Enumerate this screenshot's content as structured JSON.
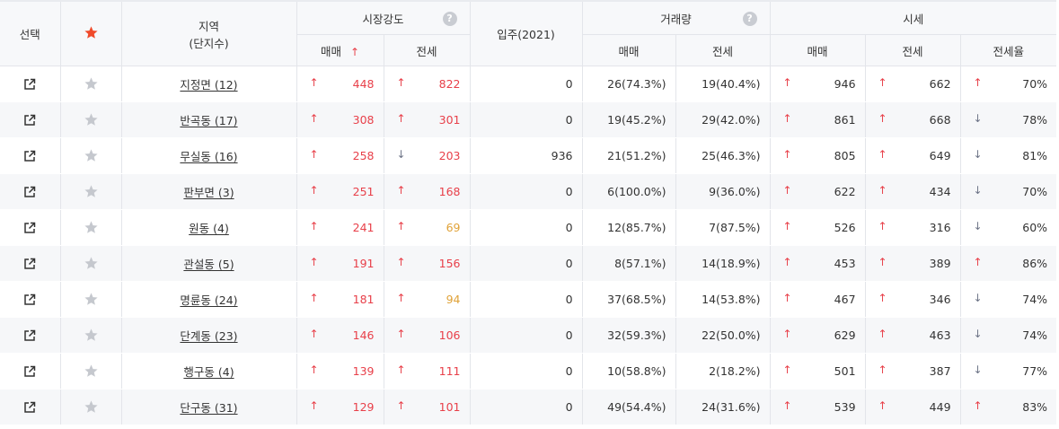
{
  "header": {
    "select": "선택",
    "region_line1": "지역",
    "region_line2": "(단지수)",
    "market_strength": "시장강도",
    "move_in": "입주(2021)",
    "volume": "거래량",
    "price": "시세",
    "sale": "매매",
    "jeonse": "전세",
    "jeonse_ratio": "전세율",
    "help_glyph": "?",
    "sort_glyph": "↑"
  },
  "colors": {
    "up": "#e8404a",
    "down": "#6d7487",
    "star_fav": "#f04a2a",
    "star": "#c5c8ce",
    "orange": "#e0a238"
  },
  "rows": [
    {
      "region": "지정면 (12)",
      "ms_sale_dir": "up",
      "ms_sale": "448",
      "ms_jeonse_dir": "up",
      "ms_jeonse": "822",
      "ms_jeonse_color": "red",
      "move_in": "0",
      "vol_sale": "26(74.3%)",
      "vol_jeonse": "19(40.4%)",
      "p_sale_dir": "up",
      "p_sale": "946",
      "p_jeonse_dir": "up",
      "p_jeonse": "662",
      "ratio_dir": "up",
      "ratio": "70%"
    },
    {
      "region": "반곡동 (17)",
      "ms_sale_dir": "up",
      "ms_sale": "308",
      "ms_jeonse_dir": "up",
      "ms_jeonse": "301",
      "ms_jeonse_color": "red",
      "move_in": "0",
      "vol_sale": "19(45.2%)",
      "vol_jeonse": "29(42.0%)",
      "p_sale_dir": "up",
      "p_sale": "861",
      "p_jeonse_dir": "up",
      "p_jeonse": "668",
      "ratio_dir": "down",
      "ratio": "78%"
    },
    {
      "region": "무실동 (16)",
      "ms_sale_dir": "up",
      "ms_sale": "258",
      "ms_jeonse_dir": "down",
      "ms_jeonse": "203",
      "ms_jeonse_color": "red",
      "move_in": "936",
      "vol_sale": "21(51.2%)",
      "vol_jeonse": "25(46.3%)",
      "p_sale_dir": "up",
      "p_sale": "805",
      "p_jeonse_dir": "up",
      "p_jeonse": "649",
      "ratio_dir": "down",
      "ratio": "81%"
    },
    {
      "region": "판부면 (3)",
      "ms_sale_dir": "up",
      "ms_sale": "251",
      "ms_jeonse_dir": "up",
      "ms_jeonse": "168",
      "ms_jeonse_color": "red",
      "move_in": "0",
      "vol_sale": "6(100.0%)",
      "vol_jeonse": "9(36.0%)",
      "p_sale_dir": "up",
      "p_sale": "622",
      "p_jeonse_dir": "up",
      "p_jeonse": "434",
      "ratio_dir": "down",
      "ratio": "70%"
    },
    {
      "region": "원동 (4)",
      "ms_sale_dir": "up",
      "ms_sale": "241",
      "ms_jeonse_dir": "up",
      "ms_jeonse": "69",
      "ms_jeonse_color": "orange",
      "move_in": "0",
      "vol_sale": "12(85.7%)",
      "vol_jeonse": "7(87.5%)",
      "p_sale_dir": "up",
      "p_sale": "526",
      "p_jeonse_dir": "up",
      "p_jeonse": "316",
      "ratio_dir": "down",
      "ratio": "60%"
    },
    {
      "region": "관설동 (5)",
      "ms_sale_dir": "up",
      "ms_sale": "191",
      "ms_jeonse_dir": "up",
      "ms_jeonse": "156",
      "ms_jeonse_color": "red",
      "move_in": "0",
      "vol_sale": "8(57.1%)",
      "vol_jeonse": "14(18.9%)",
      "p_sale_dir": "up",
      "p_sale": "453",
      "p_jeonse_dir": "up",
      "p_jeonse": "389",
      "ratio_dir": "up",
      "ratio": "86%"
    },
    {
      "region": "명륜동 (24)",
      "ms_sale_dir": "up",
      "ms_sale": "181",
      "ms_jeonse_dir": "up",
      "ms_jeonse": "94",
      "ms_jeonse_color": "orange",
      "move_in": "0",
      "vol_sale": "37(68.5%)",
      "vol_jeonse": "14(53.8%)",
      "p_sale_dir": "up",
      "p_sale": "467",
      "p_jeonse_dir": "up",
      "p_jeonse": "346",
      "ratio_dir": "down",
      "ratio": "74%"
    },
    {
      "region": "단계동 (23)",
      "ms_sale_dir": "up",
      "ms_sale": "146",
      "ms_jeonse_dir": "up",
      "ms_jeonse": "106",
      "ms_jeonse_color": "red",
      "move_in": "0",
      "vol_sale": "32(59.3%)",
      "vol_jeonse": "22(50.0%)",
      "p_sale_dir": "up",
      "p_sale": "629",
      "p_jeonse_dir": "up",
      "p_jeonse": "463",
      "ratio_dir": "down",
      "ratio": "74%"
    },
    {
      "region": "행구동 (4)",
      "ms_sale_dir": "up",
      "ms_sale": "139",
      "ms_jeonse_dir": "up",
      "ms_jeonse": "111",
      "ms_jeonse_color": "red",
      "move_in": "0",
      "vol_sale": "10(58.8%)",
      "vol_jeonse": "2(18.2%)",
      "p_sale_dir": "up",
      "p_sale": "501",
      "p_jeonse_dir": "up",
      "p_jeonse": "387",
      "ratio_dir": "down",
      "ratio": "77%"
    },
    {
      "region": "단구동 (31)",
      "ms_sale_dir": "up",
      "ms_sale": "129",
      "ms_jeonse_dir": "up",
      "ms_jeonse": "101",
      "ms_jeonse_color": "red",
      "move_in": "0",
      "vol_sale": "49(54.4%)",
      "vol_jeonse": "24(31.6%)",
      "p_sale_dir": "up",
      "p_sale": "539",
      "p_jeonse_dir": "up",
      "p_jeonse": "449",
      "ratio_dir": "up",
      "ratio": "83%"
    }
  ]
}
